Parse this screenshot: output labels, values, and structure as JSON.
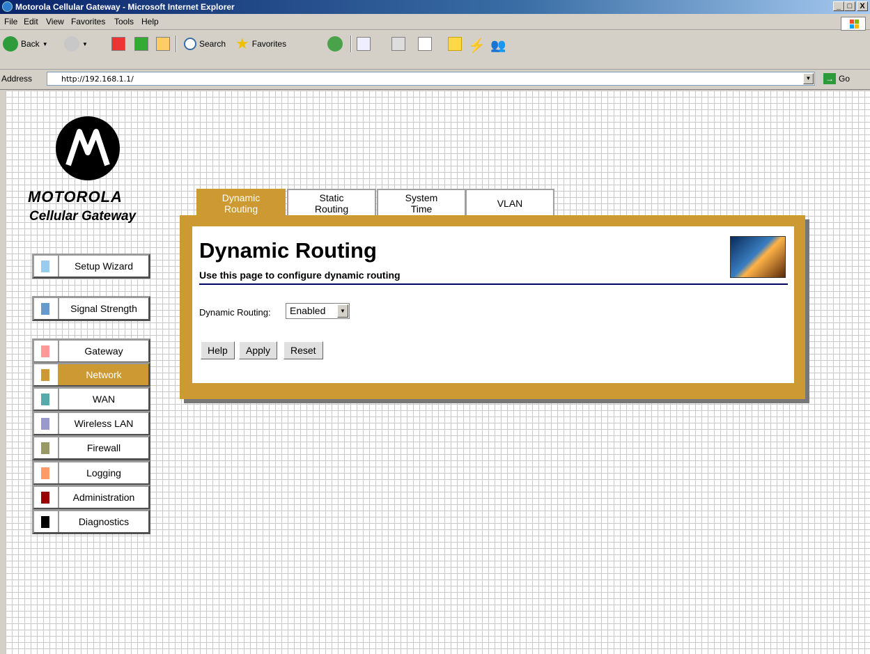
{
  "window": {
    "title": "Motorola Cellular Gateway - Microsoft Internet Explorer",
    "min": "_",
    "max": "□",
    "close": "X"
  },
  "menu": {
    "items": [
      "File",
      "Edit",
      "View",
      "Favorites",
      "Tools",
      "Help"
    ]
  },
  "toolbar": {
    "back": "Back",
    "search": "Search",
    "favorites": "Favorites"
  },
  "address": {
    "label": "Address",
    "url": "http://192.168.1.1/",
    "go": "Go"
  },
  "brand": {
    "name": "MOTOROLA",
    "product": "Cellular Gateway"
  },
  "nav": {
    "setup_wizard": {
      "label": "Setup Wizard",
      "color": "#99ccee"
    },
    "signal_strength": {
      "label": "Signal Strength",
      "color": "#6699cc"
    },
    "items": [
      {
        "label": "Gateway",
        "color": "#ff9999"
      },
      {
        "label": "Network",
        "color": "#cc9933",
        "active": true
      },
      {
        "label": "WAN",
        "color": "#55aaaa"
      },
      {
        "label": "Wireless LAN",
        "color": "#9999cc"
      },
      {
        "label": "Firewall",
        "color": "#999966"
      },
      {
        "label": "Logging",
        "color": "#ff9966"
      },
      {
        "label": "Administration",
        "color": "#990000"
      },
      {
        "label": "Diagnostics",
        "color": "#000000"
      }
    ]
  },
  "tabs": [
    {
      "line1": "Dynamic",
      "line2": "Routing",
      "active": true
    },
    {
      "line1": "Static",
      "line2": "Routing"
    },
    {
      "line1": "System",
      "line2": "Time"
    },
    {
      "line1": "VLAN",
      "line2": ""
    }
  ],
  "content": {
    "title": "Dynamic Routing",
    "subtitle": "Use this page to configure dynamic routing",
    "field_label": "Dynamic Routing:",
    "field_value": "Enabled",
    "buttons": {
      "help": "Help",
      "apply": "Apply",
      "reset": "Reset"
    }
  },
  "colors": {
    "accent": "#cc9933",
    "rule": "#000066"
  }
}
